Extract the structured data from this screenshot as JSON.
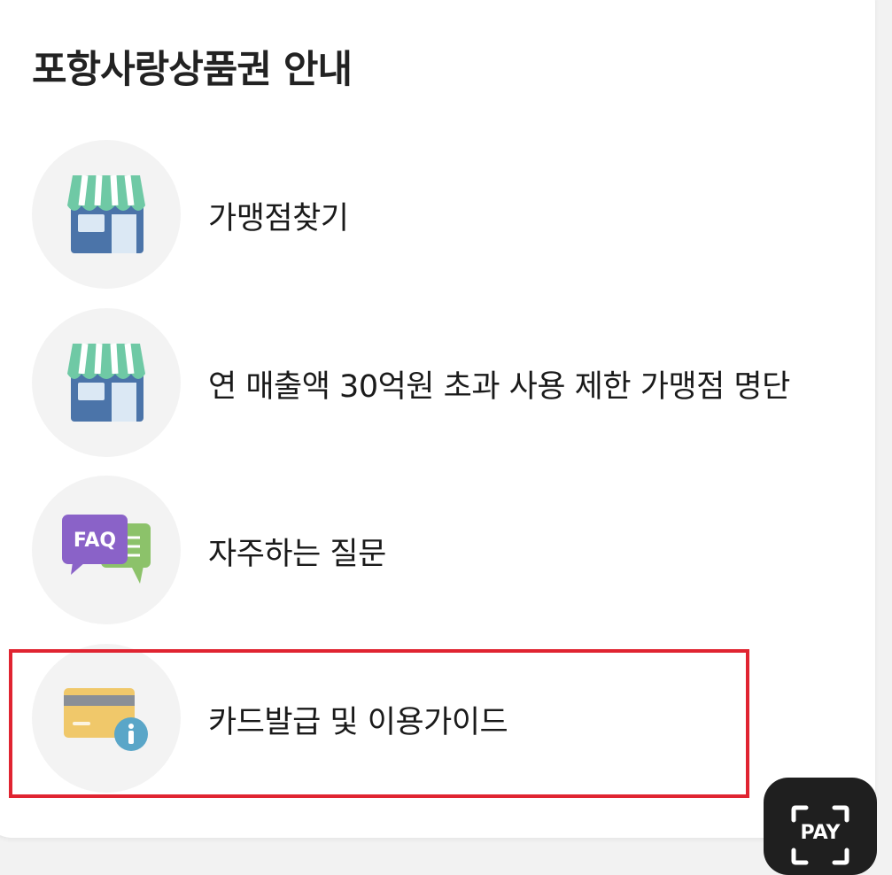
{
  "header": {
    "title": "포항사랑상품권 안내"
  },
  "menu": {
    "items": [
      {
        "label": "가맹점찾기",
        "icon": "store-icon"
      },
      {
        "label": "연 매출액 30억원 초과 사용 제한 가맹점 명단",
        "icon": "store-icon"
      },
      {
        "label": "자주하는 질문",
        "icon": "faq-icon"
      },
      {
        "label": "카드발급 및 이용가이드",
        "icon": "card-info-icon"
      }
    ]
  },
  "fab": {
    "label": "PAY",
    "icon": "scan-pay-icon"
  },
  "colors": {
    "highlight": "#e02431",
    "awning_green": "#6fc9a5",
    "store_blue": "#4b74a9",
    "faq_purple": "#8a62c8",
    "faq_green": "#8cc26a",
    "card_yellow": "#f0c86a",
    "info_blue": "#5aa6c8"
  }
}
